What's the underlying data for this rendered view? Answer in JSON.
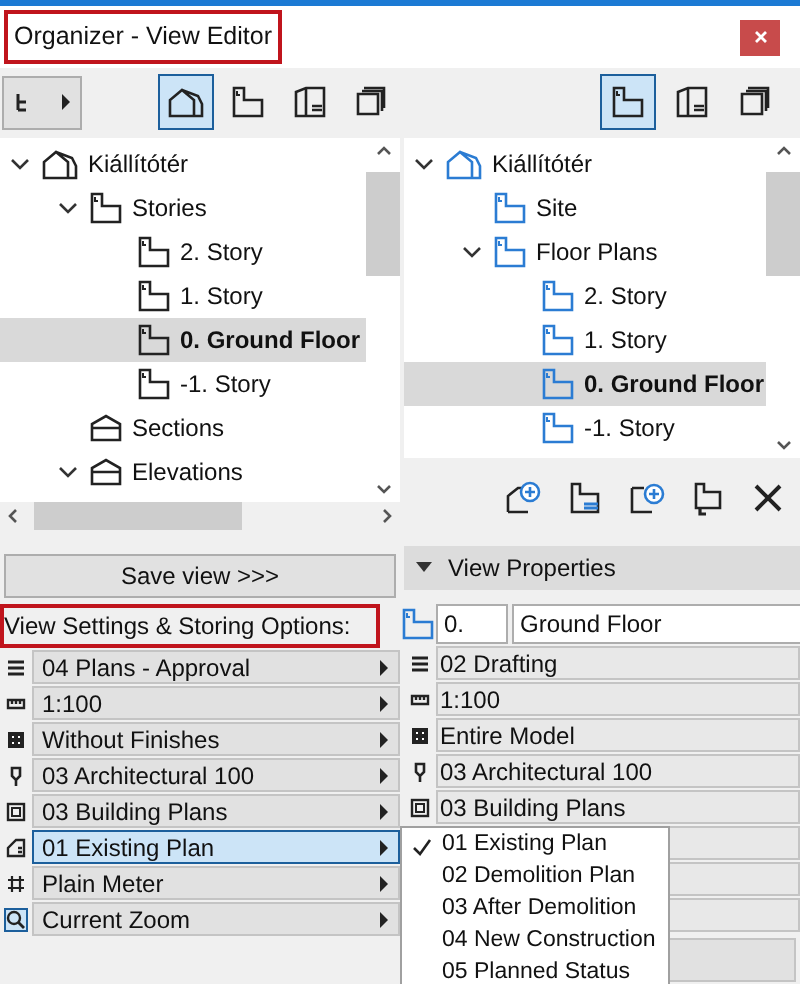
{
  "window": {
    "title": "Organizer - View Editor",
    "highlighted": true
  },
  "left_panel": {
    "toolbar": [
      {
        "kind": "project",
        "selected": true
      },
      {
        "kind": "plan",
        "selected": false
      },
      {
        "kind": "layout",
        "selected": false
      },
      {
        "kind": "set",
        "selected": false
      }
    ],
    "tree": [
      {
        "kind": "project",
        "label": "Kiállítótér",
        "expanded": true,
        "selected": false,
        "children": [
          {
            "kind": "plan",
            "label": "Stories",
            "expanded": true,
            "selected": false,
            "children": [
              {
                "kind": "plan",
                "label": "2. Story",
                "selected": false
              },
              {
                "kind": "plan",
                "label": "1. Story",
                "selected": false
              },
              {
                "kind": "plan",
                "label": "0. Ground Floor",
                "selected": true
              },
              {
                "kind": "plan",
                "label": "-1. Story",
                "selected": false
              }
            ]
          },
          {
            "kind": "section",
            "label": "Sections",
            "selected": false
          },
          {
            "kind": "section",
            "label": "Elevations",
            "expanded": true,
            "selected": false
          }
        ]
      }
    ],
    "save_button": "Save view >>>",
    "settings_label": "View Settings & Storing Options:",
    "settings": [
      {
        "label": "04 Plans - Approval",
        "selected": false
      },
      {
        "label": "1:100",
        "selected": false
      },
      {
        "label": "Without Finishes",
        "selected": false
      },
      {
        "label": "03 Architectural 100",
        "selected": false
      },
      {
        "label": "03 Building Plans",
        "selected": false
      },
      {
        "label": "01 Existing Plan",
        "selected": true
      },
      {
        "label": "Plain Meter",
        "selected": false
      },
      {
        "label": "Current Zoom",
        "selected": false
      }
    ]
  },
  "right_panel": {
    "toolbar": [
      {
        "kind": "plan",
        "selected": true
      },
      {
        "kind": "layout",
        "selected": false
      },
      {
        "kind": "set",
        "selected": false
      }
    ],
    "tree": [
      {
        "kind": "project",
        "label": "Kiállítótér",
        "expanded": true,
        "selected": false,
        "children": [
          {
            "kind": "plan",
            "label": "Site",
            "selected": false
          },
          {
            "kind": "plan",
            "label": "Floor Plans",
            "expanded": true,
            "selected": false,
            "children": [
              {
                "kind": "plan",
                "label": "2. Story",
                "selected": false
              },
              {
                "kind": "plan",
                "label": "1. Story",
                "selected": false
              },
              {
                "kind": "plan",
                "label": "0. Ground Floor",
                "selected": true
              },
              {
                "kind": "plan",
                "label": "-1. Story",
                "selected": false
              }
            ]
          }
        ]
      }
    ],
    "view_properties": {
      "title": "View Properties",
      "expanded": true,
      "id": "0.",
      "name": "Ground Floor",
      "rows": [
        "02 Drafting",
        "1:100",
        "Entire Model",
        "03 Architectural 100",
        "03 Building Plans"
      ]
    },
    "menu": [
      {
        "label": "01 Existing Plan",
        "checked": true
      },
      {
        "label": "02 Demolition Plan",
        "checked": false
      },
      {
        "label": "03 After Demolition",
        "checked": false
      },
      {
        "label": "04 New Construction",
        "checked": false
      },
      {
        "label": "05 Planned Status",
        "checked": false
      }
    ]
  }
}
